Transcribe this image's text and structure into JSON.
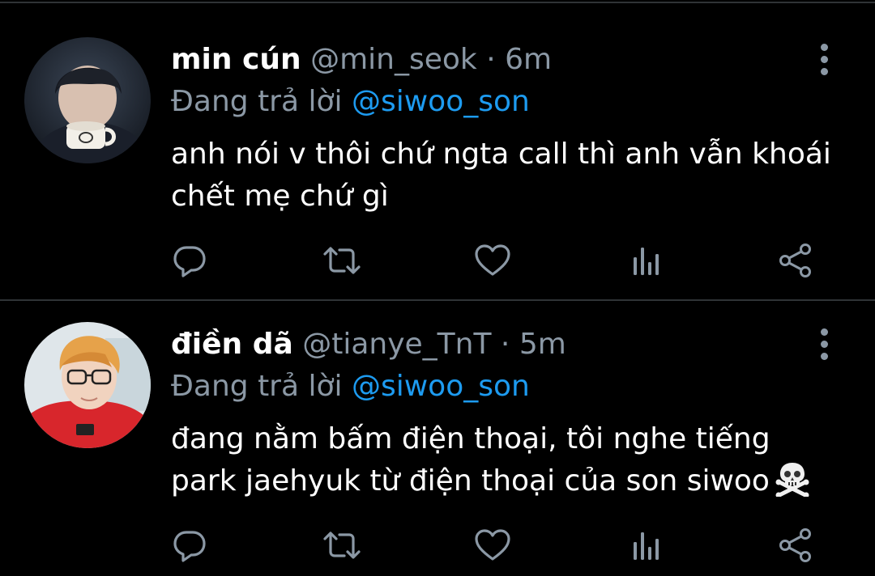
{
  "tweets": [
    {
      "display_name": "min cún",
      "handle": "@min_seok",
      "separator": "·",
      "time": "6m",
      "reply_prefix": "Đang trả lời",
      "reply_to": "@siwoo_son",
      "body_lines": [
        "anh nói v thôi chứ ngta call thì anh vẫn khoái",
        "chết mẹ chứ gì"
      ]
    },
    {
      "display_name": "điền dã",
      "handle": "@tianye_TnT",
      "separator": "·",
      "time": "5m",
      "reply_prefix": "Đang trả lời",
      "reply_to": "@siwoo_son",
      "body_lines": [
        "đang nằm bấm điện thoại, tôi nghe tiếng",
        "park jaehyuk từ điện thoại của son siwoo"
      ],
      "trailing_emoji": "skull-and-crossbones"
    }
  ],
  "actions": [
    "reply-icon",
    "retweet-icon",
    "like-icon",
    "analytics-icon",
    "share-icon"
  ],
  "colors": {
    "background": "#000000",
    "text_primary": "#ffffff",
    "text_secondary": "#8b98a5",
    "accent": "#1d9bf0",
    "divider": "#2f3336"
  }
}
